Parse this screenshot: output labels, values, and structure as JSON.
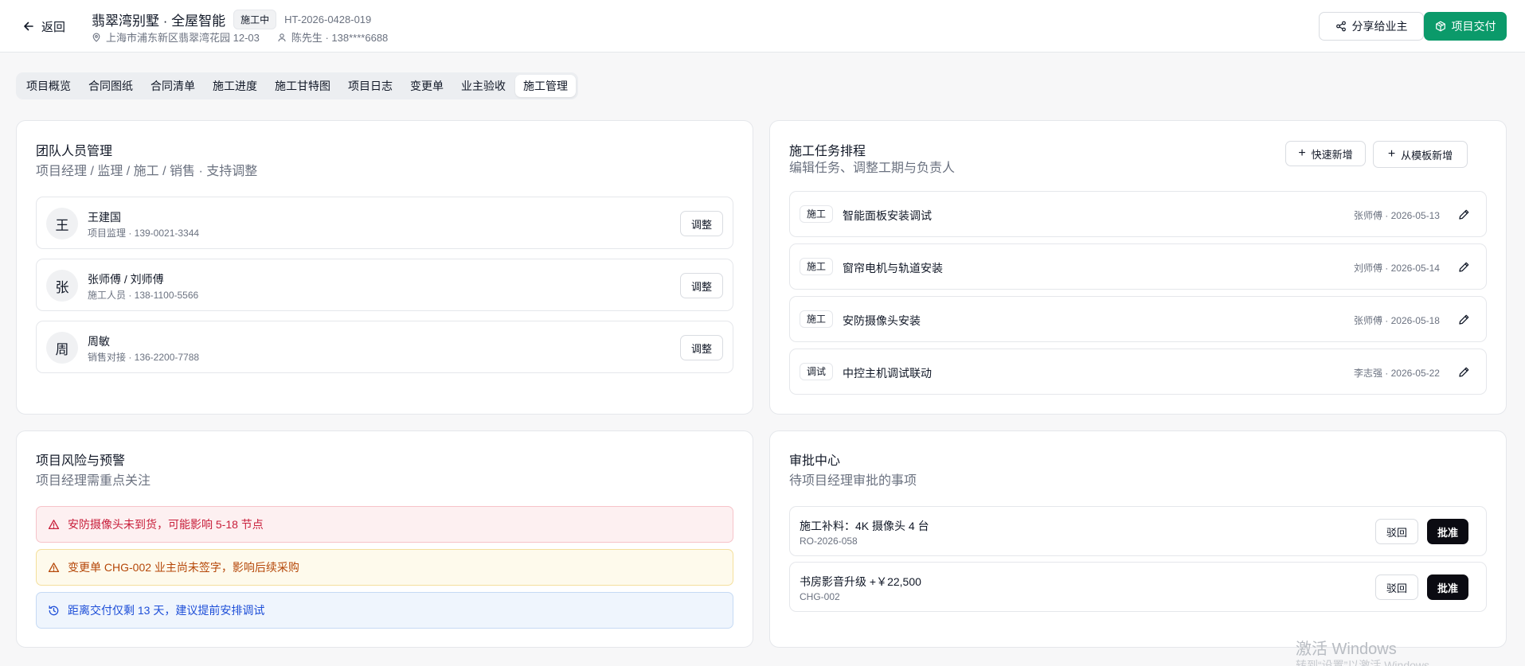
{
  "header": {
    "back_label": "返回",
    "title": "翡翠湾别墅 · 全屋智能",
    "status": "施工中",
    "contract_no": "HT-2026-0428-019",
    "address": "上海市浦东新区翡翠湾花园 12-03",
    "owner": "陈先生 · 138****6688",
    "share_label": "分享给业主",
    "deliver_label": "项目交付"
  },
  "tabs": [
    {
      "label": "项目概览"
    },
    {
      "label": "合同图纸"
    },
    {
      "label": "合同清单"
    },
    {
      "label": "施工进度"
    },
    {
      "label": "施工甘特图"
    },
    {
      "label": "项目日志"
    },
    {
      "label": "变更单"
    },
    {
      "label": "业主验收"
    },
    {
      "label": "施工管理",
      "active": true
    }
  ],
  "team": {
    "title": "团队人员管理",
    "subtitle": "项目经理 / 监理 / 施工 / 销售 · 支持调整",
    "adjust_label": "调整",
    "members": [
      {
        "avatar": "王",
        "name": "王建国",
        "info": "项目监理 · 139-0021-3344"
      },
      {
        "avatar": "张",
        "name": "张师傅 / 刘师傅",
        "info": "施工人员 · 138-1100-5566"
      },
      {
        "avatar": "周",
        "name": "周敏",
        "info": "销售对接 · 136-2200-7788"
      }
    ]
  },
  "schedule": {
    "title": "施工任务排程",
    "subtitle": "编辑任务、调整工期与负责人",
    "quick_add_label": "快速新增",
    "template_add_label": "从模板新增",
    "tasks": [
      {
        "tag": "施工",
        "name": "智能面板安装调试",
        "meta": "张师傅 · 2026-05-13"
      },
      {
        "tag": "施工",
        "name": "窗帘电机与轨道安装",
        "meta": "刘师傅 · 2026-05-14"
      },
      {
        "tag": "施工",
        "name": "安防摄像头安装",
        "meta": "张师傅 · 2026-05-18"
      },
      {
        "tag": "调试",
        "name": "中控主机调试联动",
        "meta": "李志强 · 2026-05-22"
      }
    ]
  },
  "risks": {
    "title": "项目风险与预警",
    "subtitle": "项目经理需重点关注",
    "items": [
      {
        "level": "danger",
        "text": "安防摄像头未到货，可能影响 5-18 节点"
      },
      {
        "level": "warning",
        "text": "变更单 CHG-002 业主尚未签字，影响后续采购"
      },
      {
        "level": "info",
        "text": "距离交付仅剩 13 天，建议提前安排调试"
      }
    ]
  },
  "approvals": {
    "title": "审批中心",
    "subtitle": "待项目经理审批的事项",
    "reject_label": "驳回",
    "approve_label": "批准",
    "items": [
      {
        "title": "施工补料：4K 摄像头 4 台",
        "code": "RO-2026-058"
      },
      {
        "title": "书房影音升级 +￥22,500",
        "code": "CHG-002"
      }
    ]
  },
  "watermark": {
    "line1": "激活 Windows",
    "line2": "转到“设置”以激活 Windows。"
  },
  "colors": {
    "accent_green": "#0b9a6a",
    "danger": "#c81e3a",
    "warning": "#b54708",
    "info": "#1d4ed8"
  }
}
